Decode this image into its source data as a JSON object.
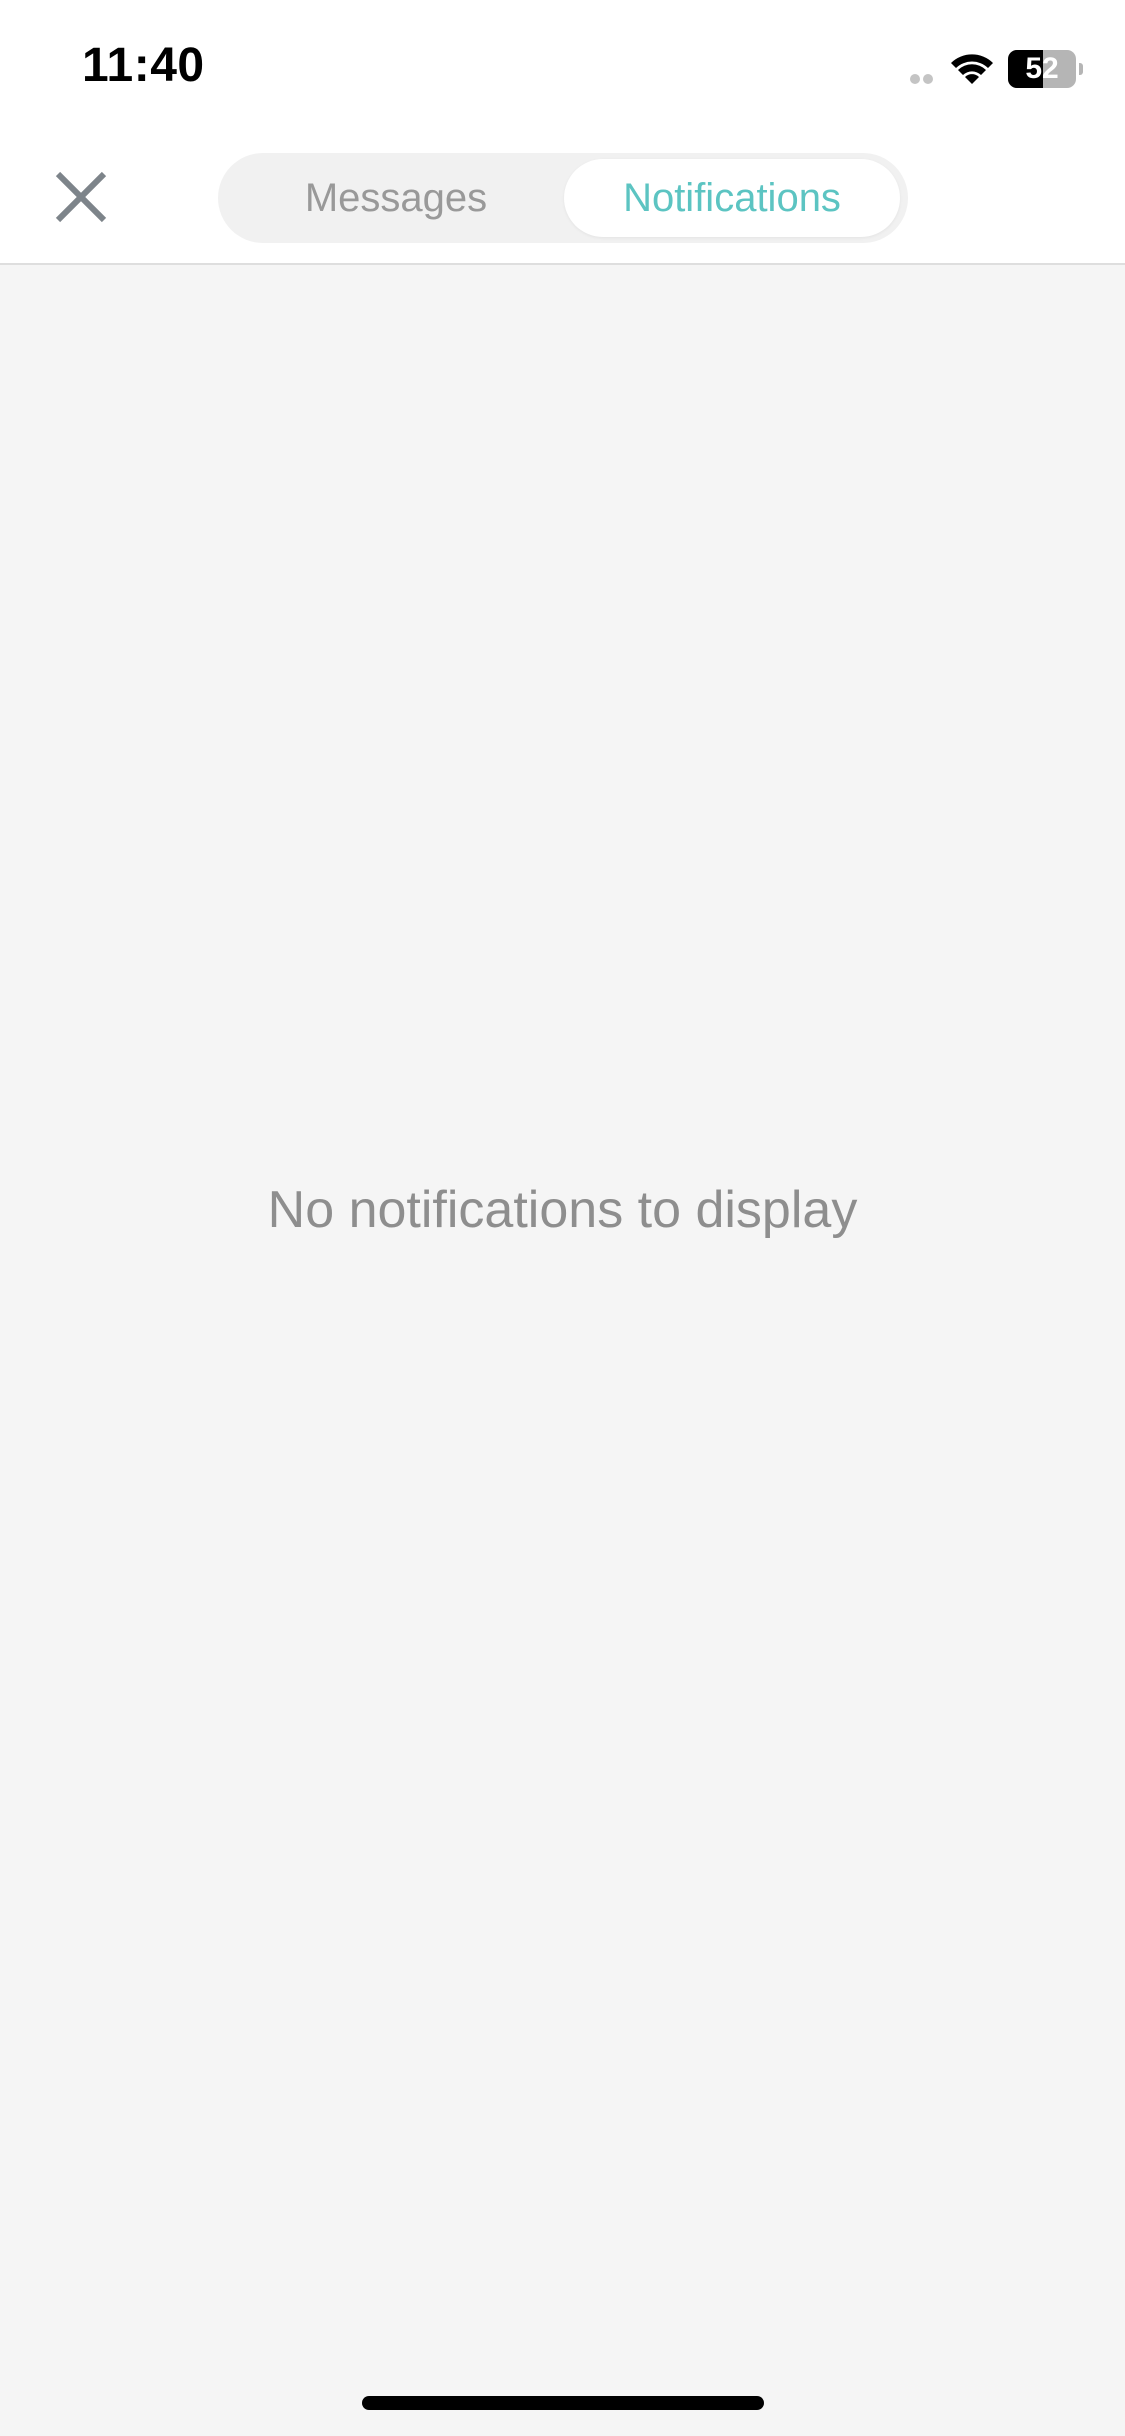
{
  "status_bar": {
    "time": "11:40",
    "battery_level": "52",
    "battery_percent": 52,
    "icons": [
      "signal-icon",
      "wifi-icon",
      "battery-icon"
    ]
  },
  "header": {
    "close_icon": "close-icon",
    "tabs": [
      {
        "label": "Messages",
        "selected": false
      },
      {
        "label": "Notifications",
        "selected": true
      }
    ]
  },
  "content": {
    "empty_message": "No notifications to display"
  },
  "colors": {
    "accent": "#5cc4c2",
    "inactive_tab_text": "#999999",
    "empty_text": "#8e8e8e",
    "background": "#f5f5f5",
    "header_background": "#ffffff",
    "close_icon": "#7d848a"
  }
}
